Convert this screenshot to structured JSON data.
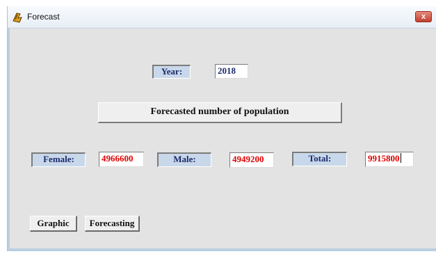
{
  "window": {
    "title": "Forecast",
    "close_label": "x"
  },
  "year": {
    "label": "Year:",
    "value": "2018"
  },
  "banner": "Forecasted number of population",
  "female": {
    "label": "Female:",
    "value": "4966600"
  },
  "male": {
    "label": "Male:",
    "value": "4949200"
  },
  "total": {
    "label": "Total:",
    "value": "9915800"
  },
  "buttons": {
    "graphic": "Graphic",
    "forecasting": "Forecasting"
  },
  "colors": {
    "label_bg": "#c8d8ea",
    "label_text": "#1b2a6b",
    "value_red": "#e00000",
    "window_bg": "#e3e3e3"
  },
  "icons": {
    "app": "delphi-helmet-icon",
    "close": "close-icon"
  }
}
